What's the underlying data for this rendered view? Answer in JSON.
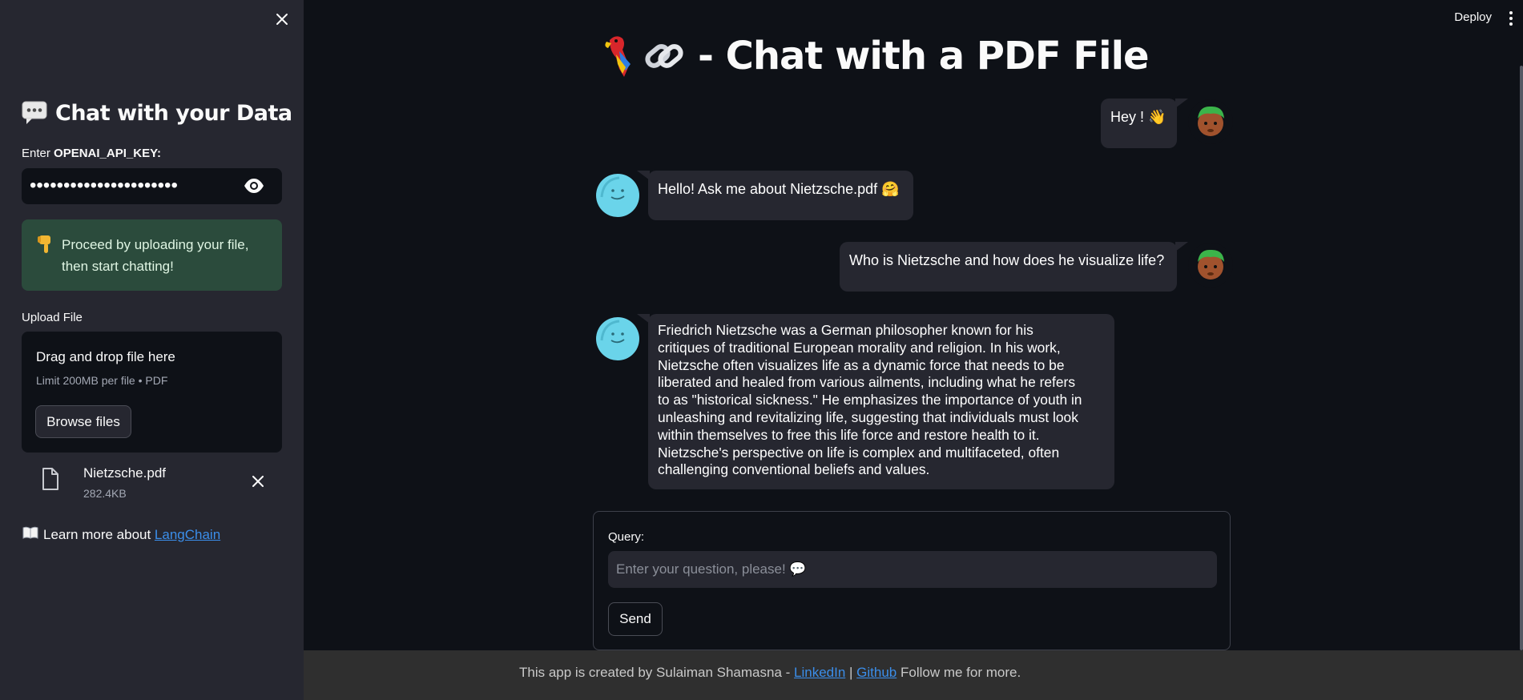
{
  "sidebar": {
    "title": "Chat with your Data",
    "title_icon": "speech-bubble-icon",
    "api_key_label_prefix": "Enter ",
    "api_key_label_name": "OPENAI_API_KEY:",
    "api_key_value": "••••••••••••••••••••••",
    "info_icon": "pointing-down-icon",
    "info_text_line1": "Proceed by uploading your file,",
    "info_text_line2": "then start chatting!",
    "upload_label": "Upload File",
    "dropzone_title": "Drag and drop file here",
    "dropzone_limit": "Limit 200MB per file • PDF",
    "browse_label": "Browse files",
    "file_name": "Nietzsche.pdf",
    "file_size": "282.4KB",
    "learn_prefix": "Learn more about ",
    "learn_link": "LangChain",
    "learn_icon": "book-icon"
  },
  "header": {
    "deploy_label": "Deploy"
  },
  "main": {
    "title": "- Chat with a PDF File",
    "title_icons": [
      "parrot-icon",
      "link-icon"
    ]
  },
  "messages": [
    {
      "role": "user",
      "text": "Hey ! 👋"
    },
    {
      "role": "bot",
      "text": "Hello! Ask me about Nietzsche.pdf 🤗"
    },
    {
      "role": "user",
      "text": "Who is Nietzsche and how does he visualize life?"
    },
    {
      "role": "bot",
      "lines": [
        "Friedrich Nietzsche was a German philosopher known for his",
        "critiques of traditional European morality and religion. In his work,",
        "Nietzsche often visualizes life as a dynamic force that needs to be",
        "liberated and healed from various ailments, including what he refers",
        "to as \"historical sickness.\" He emphasizes the importance of youth in",
        "unleashing and revitalizing life, suggesting that individuals must look",
        "within themselves to free this life force and restore health to it.",
        "Nietzsche's perspective on life is complex and multifaceted, often",
        "challenging conventional beliefs and values."
      ]
    }
  ],
  "query": {
    "label": "Query:",
    "placeholder": "Enter your question, please! 💬",
    "send_label": "Send"
  },
  "footer": {
    "prefix": "This app is created by Sulaiman Shamasna - ",
    "link1": "LinkedIn",
    "sep": " | ",
    "link2": "Github",
    "suffix": " Follow me for more."
  },
  "colors": {
    "sidebar_bg": "#262730",
    "main_bg": "#0e1117",
    "info_bg": "#2b4b3c",
    "link": "#3b8eea",
    "bot_avatar": "#6ad4ea"
  }
}
